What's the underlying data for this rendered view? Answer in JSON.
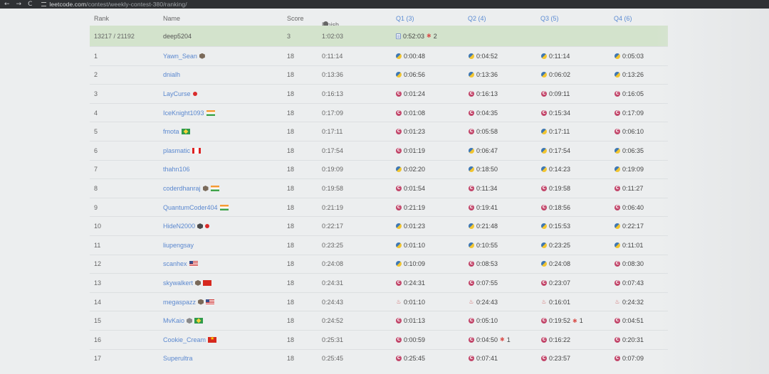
{
  "browser": {
    "back": "←",
    "forward": "→",
    "reload": "C",
    "url_host": "leetcode.com",
    "url_path": "/contest/weekly-contest-380/ranking/"
  },
  "colors": {
    "accent": "#5b88cf",
    "highlight_row": "#d3e3cc",
    "cpp": "#c2466a",
    "bug": "#d9534f"
  },
  "headers": {
    "rank": "Rank",
    "name": "Name",
    "score": "Score",
    "finish": "Finish Time",
    "q1": "Q1 (3)",
    "q2": "Q2 (4)",
    "q3": "Q3 (5)",
    "q4": "Q4 (6)"
  },
  "me": {
    "rank": "13217 / 21192",
    "name": "deep5204",
    "score": "3",
    "finish": "1:02:03",
    "q1": "0:52:03",
    "q1_wa": "2"
  },
  "rows": [
    {
      "rank": "1",
      "name": "Yawn_Sean",
      "badge": "hex",
      "flag": "",
      "score": "18",
      "finish": "0:11:14",
      "q": [
        {
          "t": "0:00:48",
          "l": "py"
        },
        {
          "t": "0:04:52",
          "l": "py"
        },
        {
          "t": "0:11:14",
          "l": "py"
        },
        {
          "t": "0:05:03",
          "l": "py"
        }
      ]
    },
    {
      "rank": "2",
      "name": "dnialh",
      "badge": "",
      "flag": "",
      "score": "18",
      "finish": "0:13:36",
      "q": [
        {
          "t": "0:06:56",
          "l": "py"
        },
        {
          "t": "0:13:36",
          "l": "py"
        },
        {
          "t": "0:06:02",
          "l": "py"
        },
        {
          "t": "0:13:26",
          "l": "py"
        }
      ]
    },
    {
      "rank": "3",
      "name": "LayCurse",
      "badge": "",
      "flag": "jp",
      "score": "18",
      "finish": "0:16:13",
      "q": [
        {
          "t": "0:01:24",
          "l": "cpp"
        },
        {
          "t": "0:16:13",
          "l": "cpp"
        },
        {
          "t": "0:09:11",
          "l": "cpp"
        },
        {
          "t": "0:16:05",
          "l": "cpp"
        }
      ]
    },
    {
      "rank": "4",
      "name": "IceKnight1093",
      "badge": "",
      "flag": "in",
      "score": "18",
      "finish": "0:17:09",
      "q": [
        {
          "t": "0:01:08",
          "l": "cpp"
        },
        {
          "t": "0:04:35",
          "l": "cpp"
        },
        {
          "t": "0:15:34",
          "l": "cpp"
        },
        {
          "t": "0:17:09",
          "l": "cpp"
        }
      ]
    },
    {
      "rank": "5",
      "name": "fmota",
      "badge": "",
      "flag": "br",
      "score": "18",
      "finish": "0:17:11",
      "q": [
        {
          "t": "0:01:23",
          "l": "cpp"
        },
        {
          "t": "0:05:58",
          "l": "cpp"
        },
        {
          "t": "0:17:11",
          "l": "py"
        },
        {
          "t": "0:06:10",
          "l": "cpp"
        }
      ]
    },
    {
      "rank": "6",
      "name": "plasmatic",
      "badge": "",
      "flag": "ca",
      "score": "18",
      "finish": "0:17:54",
      "q": [
        {
          "t": "0:01:19",
          "l": "cpp"
        },
        {
          "t": "0:06:47",
          "l": "py"
        },
        {
          "t": "0:17:54",
          "l": "py"
        },
        {
          "t": "0:06:35",
          "l": "py"
        }
      ]
    },
    {
      "rank": "7",
      "name": "thahn106",
      "badge": "",
      "flag": "",
      "score": "18",
      "finish": "0:19:09",
      "q": [
        {
          "t": "0:02:20",
          "l": "py"
        },
        {
          "t": "0:18:50",
          "l": "py"
        },
        {
          "t": "0:14:23",
          "l": "py"
        },
        {
          "t": "0:19:09",
          "l": "py"
        }
      ]
    },
    {
      "rank": "8",
      "name": "coderdhanraj",
      "badge": "hex",
      "flag": "in",
      "score": "18",
      "finish": "0:19:58",
      "q": [
        {
          "t": "0:01:54",
          "l": "cpp"
        },
        {
          "t": "0:11:34",
          "l": "cpp"
        },
        {
          "t": "0:19:58",
          "l": "cpp"
        },
        {
          "t": "0:11:27",
          "l": "cpp"
        }
      ]
    },
    {
      "rank": "9",
      "name": "QuantumCoder404",
      "badge": "",
      "flag": "in",
      "score": "18",
      "finish": "0:21:19",
      "q": [
        {
          "t": "0:21:19",
          "l": "cpp"
        },
        {
          "t": "0:19:41",
          "l": "cpp"
        },
        {
          "t": "0:18:56",
          "l": "cpp"
        },
        {
          "t": "0:06:40",
          "l": "cpp"
        }
      ]
    },
    {
      "rank": "10",
      "name": "HideN2000",
      "badge": "dark",
      "flag": "jp",
      "score": "18",
      "finish": "0:22:17",
      "q": [
        {
          "t": "0:01:23",
          "l": "py"
        },
        {
          "t": "0:21:48",
          "l": "py"
        },
        {
          "t": "0:15:53",
          "l": "py"
        },
        {
          "t": "0:22:17",
          "l": "py"
        }
      ]
    },
    {
      "rank": "11",
      "name": "liupengsay",
      "badge": "",
      "flag": "",
      "score": "18",
      "finish": "0:23:25",
      "q": [
        {
          "t": "0:01:10",
          "l": "py"
        },
        {
          "t": "0:10:55",
          "l": "py"
        },
        {
          "t": "0:23:25",
          "l": "py"
        },
        {
          "t": "0:11:01",
          "l": "py"
        }
      ]
    },
    {
      "rank": "12",
      "name": "scanhex",
      "badge": "",
      "flag": "us",
      "score": "18",
      "finish": "0:24:08",
      "q": [
        {
          "t": "0:10:09",
          "l": "py"
        },
        {
          "t": "0:08:53",
          "l": "cpp"
        },
        {
          "t": "0:24:08",
          "l": "py"
        },
        {
          "t": "0:08:30",
          "l": "cpp"
        }
      ]
    },
    {
      "rank": "13",
      "name": "skywalkert",
      "badge": "hex",
      "flag": "cn",
      "score": "18",
      "finish": "0:24:31",
      "q": [
        {
          "t": "0:24:31",
          "l": "cpp"
        },
        {
          "t": "0:07:55",
          "l": "cpp"
        },
        {
          "t": "0:23:07",
          "l": "cpp"
        },
        {
          "t": "0:07:43",
          "l": "cpp"
        }
      ]
    },
    {
      "rank": "14",
      "name": "megaspazz",
      "badge": "hex",
      "flag": "us",
      "score": "18",
      "finish": "0:24:43",
      "q": [
        {
          "t": "0:01:10",
          "l": "java"
        },
        {
          "t": "0:24:43",
          "l": "java"
        },
        {
          "t": "0:16:01",
          "l": "java"
        },
        {
          "t": "0:24:32",
          "l": "java"
        }
      ]
    },
    {
      "rank": "15",
      "name": "MvKaio",
      "badge": "grey",
      "flag": "br",
      "score": "18",
      "finish": "0:24:52",
      "q": [
        {
          "t": "0:01:13",
          "l": "cpp"
        },
        {
          "t": "0:05:10",
          "l": "cpp"
        },
        {
          "t": "0:19:52",
          "l": "cpp",
          "wa": "1"
        },
        {
          "t": "0:04:51",
          "l": "cpp"
        }
      ]
    },
    {
      "rank": "16",
      "name": "Cookie_Cream",
      "badge": "",
      "flag": "vn",
      "score": "18",
      "finish": "0:25:31",
      "q": [
        {
          "t": "0:00:59",
          "l": "cpp"
        },
        {
          "t": "0:04:50",
          "l": "cpp",
          "wa": "1"
        },
        {
          "t": "0:16:22",
          "l": "cpp"
        },
        {
          "t": "0:20:31",
          "l": "cpp"
        }
      ]
    },
    {
      "rank": "17",
      "name": "Superultra",
      "badge": "",
      "flag": "",
      "score": "18",
      "finish": "0:25:45",
      "q": [
        {
          "t": "0:25:45",
          "l": "cpp"
        },
        {
          "t": "0:07:41",
          "l": "cpp"
        },
        {
          "t": "0:23:57",
          "l": "cpp"
        },
        {
          "t": "0:07:09",
          "l": "cpp"
        }
      ]
    }
  ]
}
